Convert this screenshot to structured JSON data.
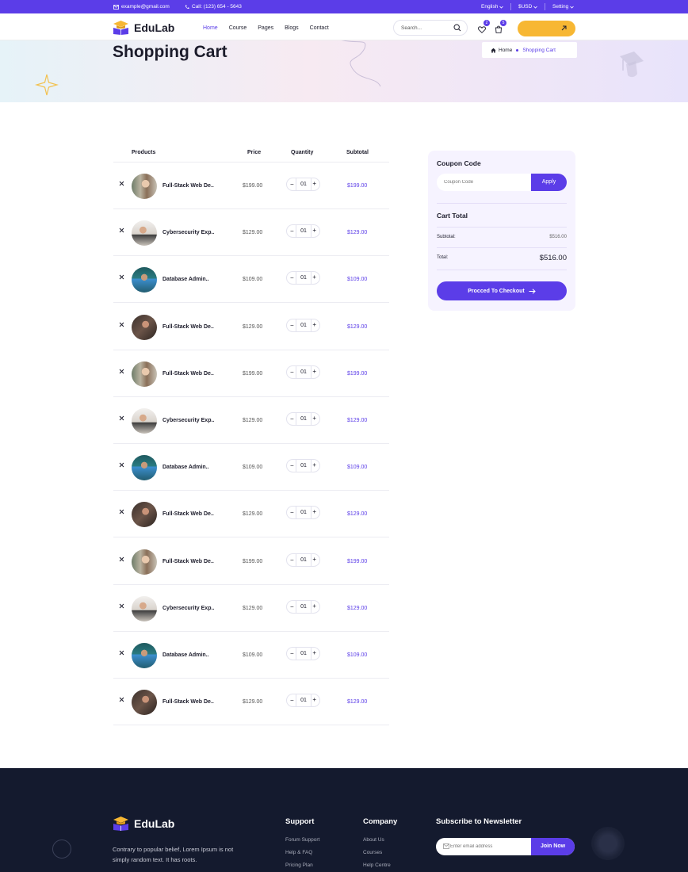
{
  "topbar": {
    "email": "example@gmail.com",
    "phone": "Call: (123) 654 - 5643",
    "language": "English",
    "currency": "$USD",
    "setting": "Setting"
  },
  "header": {
    "logo": "EduLab",
    "nav": [
      "Home",
      "Course",
      "Pages",
      "Blogs",
      "Contact"
    ],
    "active_nav": "Home",
    "search_placeholder": "Search...",
    "wishlist_count": "2",
    "cart_count": "5"
  },
  "hero": {
    "title": "Shopping Cart",
    "breadcrumb_home": "Home",
    "breadcrumb_current": "Shopping Cart"
  },
  "cart": {
    "headers": [
      "Products",
      "Price",
      "Quantity",
      "Subtotal"
    ],
    "items": [
      {
        "name": "Full-Stack Web De..",
        "price": "$199.00",
        "qty": "01",
        "subtotal": "$199.00",
        "photo": "library"
      },
      {
        "name": "Cybersecurity Exp..",
        "price": "$129.00",
        "qty": "01",
        "subtotal": "$129.00",
        "photo": "laptop"
      },
      {
        "name": "Database Admin..",
        "price": "$109.00",
        "qty": "01",
        "subtotal": "$109.00",
        "photo": "teal"
      },
      {
        "name": "Full-Stack Web De..",
        "price": "$129.00",
        "qty": "01",
        "subtotal": "$129.00",
        "photo": "dark"
      },
      {
        "name": "Full-Stack Web De..",
        "price": "$199.00",
        "qty": "01",
        "subtotal": "$199.00",
        "photo": "library"
      },
      {
        "name": "Cybersecurity Exp..",
        "price": "$129.00",
        "qty": "01",
        "subtotal": "$129.00",
        "photo": "laptop"
      },
      {
        "name": "Database Admin..",
        "price": "$109.00",
        "qty": "01",
        "subtotal": "$109.00",
        "photo": "teal"
      },
      {
        "name": "Full-Stack Web De..",
        "price": "$129.00",
        "qty": "01",
        "subtotal": "$129.00",
        "photo": "dark"
      },
      {
        "name": "Full-Stack Web De..",
        "price": "$199.00",
        "qty": "01",
        "subtotal": "$199.00",
        "photo": "library"
      },
      {
        "name": "Cybersecurity Exp..",
        "price": "$129.00",
        "qty": "01",
        "subtotal": "$129.00",
        "photo": "laptop"
      },
      {
        "name": "Database Admin..",
        "price": "$109.00",
        "qty": "01",
        "subtotal": "$109.00",
        "photo": "teal"
      },
      {
        "name": "Full-Stack Web De..",
        "price": "$129.00",
        "qty": "01",
        "subtotal": "$129.00",
        "photo": "dark"
      }
    ]
  },
  "summary": {
    "coupon_title": "Coupon Code",
    "coupon_placeholder": "Coupon Code",
    "apply_label": "Apply",
    "cart_total_title": "Cart Total",
    "subtotal_label": "Subtotal:",
    "subtotal_value": "$516.00",
    "total_label": "Total:",
    "total_value": "$516.00",
    "checkout_label": "Procced To Checkout"
  },
  "footer": {
    "logo": "EduLab",
    "description": "Contrary to popular belief, Lorem Ipsum is not simply random text. It has roots.",
    "support_title": "Support",
    "support_links": [
      "Forum Support",
      "Help & FAQ",
      "Pricing Plan"
    ],
    "company_title": "Company",
    "company_links": [
      "About Us",
      "Courses",
      "Help Centre"
    ],
    "newsletter_title": "Subscribe to Newsletter",
    "newsletter_placeholder": "Enter email address",
    "join_label": "Join Now"
  },
  "colors": {
    "accent": "#5b3de8",
    "cta": "#f7b733",
    "footer_bg": "#141a2e",
    "panel_bg": "#f6f3ff"
  }
}
